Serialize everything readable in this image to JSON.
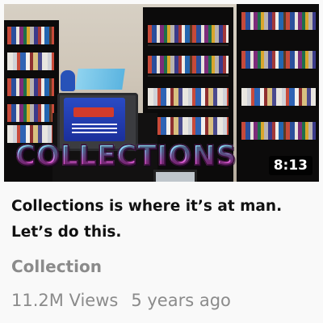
{
  "thumbnail": {
    "overlay_text": "COLLECTIONS",
    "duration": "8:13"
  },
  "video": {
    "title": "Collections is where it’s at man. Let’s do this.",
    "channel": "Collection",
    "views": "11.2M Views",
    "age": "5 years ago"
  },
  "colors": {
    "background": "#f9f9f9",
    "title_text": "#111111",
    "secondary_text": "#8b8b8b",
    "duration_badge_bg": "#000000"
  }
}
